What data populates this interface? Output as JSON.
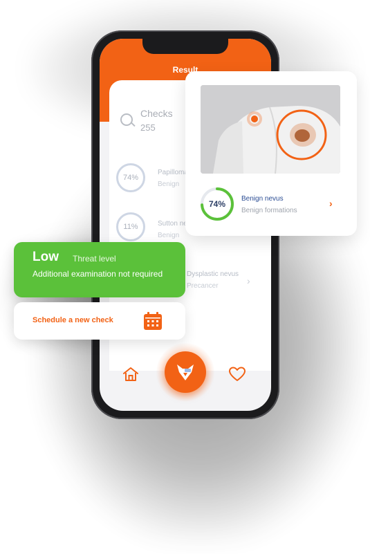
{
  "screen": {
    "title": "Result",
    "checks_label": "Checks",
    "checks_count": "255",
    "rows": [
      {
        "percent": "74%",
        "title": "Papilloma",
        "subtitle": "Benign"
      },
      {
        "percent": "11%",
        "title": "Sutton nevus",
        "subtitle": "Benign"
      },
      {
        "percent": "",
        "title": "Dysplastic nevus",
        "subtitle": "Precancer"
      }
    ]
  },
  "result_card": {
    "percent": 74,
    "percent_label": "74%",
    "diagnosis": "Benign nevus",
    "category": "Benign formations"
  },
  "threat_card": {
    "level": "Low",
    "label": "Threat level",
    "note": "Additional examination not required"
  },
  "schedule_card": {
    "label": "Schedule a new check"
  },
  "tabbar": {
    "items": [
      "home-icon",
      "scan-button",
      "heart-icon"
    ]
  },
  "colors": {
    "accent": "#f26215",
    "success": "#5bc13a",
    "navy": "#2a4c93"
  }
}
